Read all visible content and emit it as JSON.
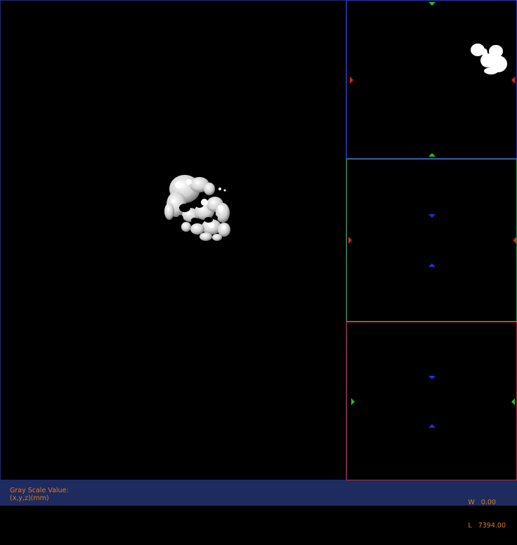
{
  "status": {
    "gray_label": "Gray Scale Value:",
    "coord_label": "(x,y,z)(mm)",
    "window_label": "W",
    "window_value": "0.00",
    "level_label": "L",
    "level_value": "7394.00"
  },
  "colors": {
    "background": "#000000",
    "status_bar": "#1e2b5e",
    "status_text": "#e07a1a",
    "marker_red": "#e02020",
    "marker_green": "#20c020",
    "marker_blue": "#2030e0"
  }
}
